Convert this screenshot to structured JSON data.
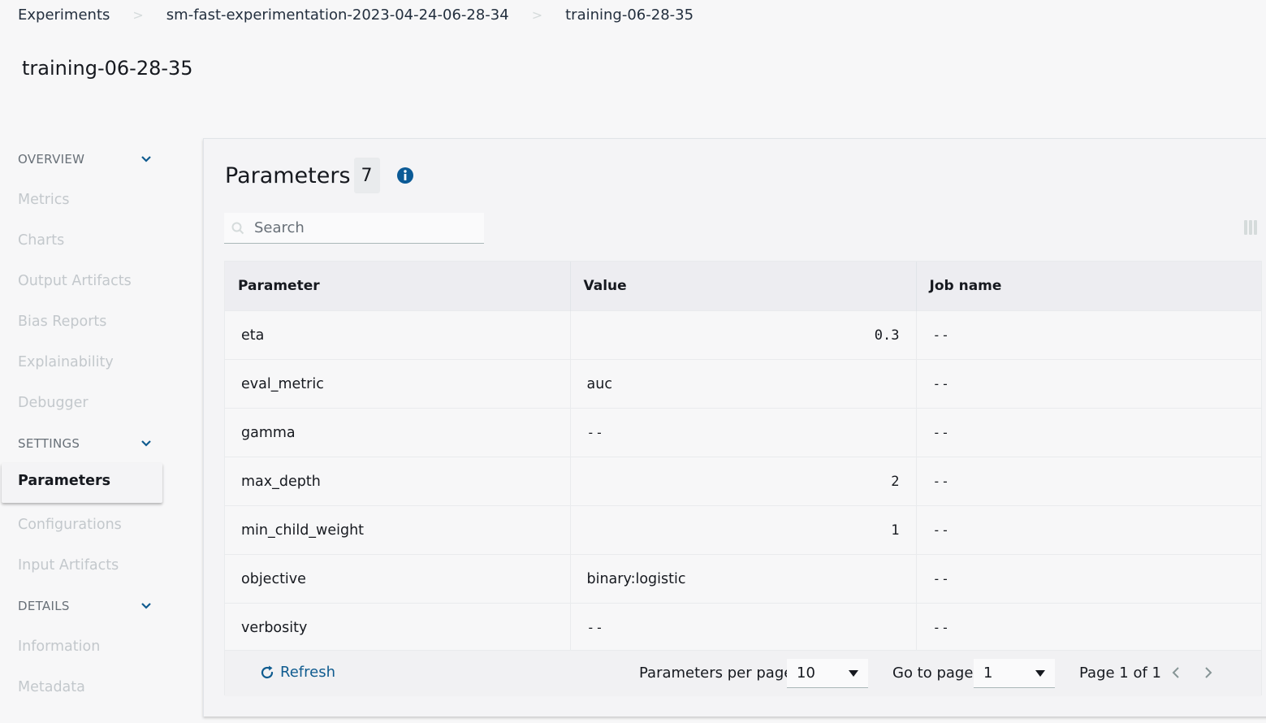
{
  "breadcrumb": {
    "items": [
      "Experiments",
      "sm-fast-experimentation-2023-04-24-06-28-34",
      "training-06-28-35"
    ],
    "separator": ">"
  },
  "page_title": "training-06-28-35",
  "sidebar": {
    "sections": {
      "overview": "OVERVIEW",
      "settings": "SETTINGS",
      "details": "DETAILS"
    },
    "items": {
      "metrics": "Metrics",
      "charts": "Charts",
      "output_artifacts": "Output Artifacts",
      "bias_reports": "Bias Reports",
      "explainability": "Explainability",
      "debugger": "Debugger",
      "parameters": "Parameters",
      "configurations": "Configurations",
      "input_artifacts": "Input Artifacts",
      "information": "Information",
      "metadata": "Metadata"
    },
    "active_item": "Parameters"
  },
  "panel": {
    "title": "Parameters",
    "count": "7",
    "search_placeholder": "Search"
  },
  "table": {
    "columns": [
      "Parameter",
      "Value",
      "Job name"
    ],
    "rows": [
      {
        "parameter": "eta",
        "value": "0.3",
        "job_name": "--"
      },
      {
        "parameter": "eval_metric",
        "value": "auc",
        "job_name": "--"
      },
      {
        "parameter": "gamma",
        "value": "--",
        "job_name": "--"
      },
      {
        "parameter": "max_depth",
        "value": "2",
        "job_name": "--"
      },
      {
        "parameter": "min_child_weight",
        "value": "1",
        "job_name": "--"
      },
      {
        "parameter": "objective",
        "value": "binary:logistic",
        "job_name": "--"
      },
      {
        "parameter": "verbosity",
        "value": "--",
        "job_name": "--"
      }
    ]
  },
  "footer": {
    "refresh_label": "Refresh",
    "per_page_label": "Parameters per page",
    "per_page_value": "10",
    "goto_label": "Go to page",
    "goto_value": "1",
    "page_indicator": "Page 1 of 1"
  },
  "icons": {
    "info": "info-icon",
    "search": "search-icon",
    "refresh": "refresh-icon",
    "columns": "columns-icon",
    "chevron": "chevron-down-icon",
    "prev": "chevron-left-icon",
    "next": "chevron-right-icon"
  },
  "colors": {
    "accent": "#0f5b8f",
    "info_icon": "#0b5a96",
    "disabled_text": "#c3c8cc"
  }
}
